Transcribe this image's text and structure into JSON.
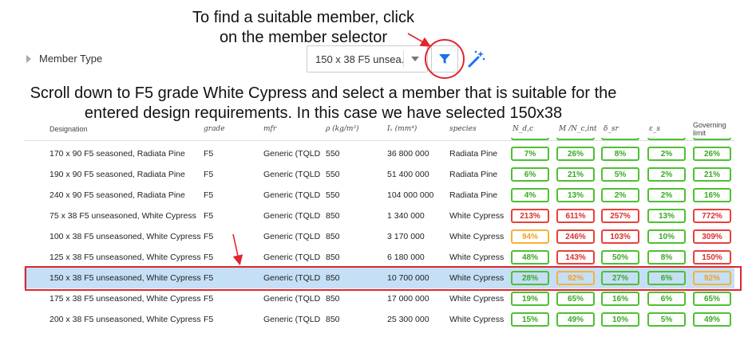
{
  "annotations": {
    "line1": "To find a suitable member, click",
    "line2": "on the member selector",
    "line3": "Scroll down to F5 grade White Cypress and select a member that is suitable for the",
    "line4": "entered design requirements. In this case we have selected 150x38"
  },
  "member": {
    "label": "Member Type",
    "selected": "150 x 38 F5 unsea..."
  },
  "icons": {
    "filter": "filter-icon",
    "wand": "magic-wand-icon",
    "expand": "expand-triangle-icon"
  },
  "colors": {
    "accent": "#1a73e8",
    "ok": "#4ec032",
    "warn": "#f5b13a",
    "fail": "#e8413c",
    "selected_row": "#c5dff6",
    "annotation": "#e0262c"
  },
  "table": {
    "headers": {
      "designation": "Designation",
      "grade": "grade",
      "mfr": "mfr",
      "rho": "ρ (kg/m³)",
      "ix": "Iₓ (mm⁴)",
      "species": "species",
      "ndc": "N_d,c",
      "mnc": "M /N_c,int",
      "dsr": "δ_sr",
      "es": "ε_s",
      "gov1": "Governing",
      "gov2": "limit"
    },
    "rows": [
      {
        "designation": "170 x 90 F5 seasoned, Radiata Pine",
        "grade": "F5",
        "mfr": "Generic (TQLD",
        "rho": "550",
        "ix": "36 800 000",
        "species": "Radiata Pine",
        "c1": "7%",
        "s1": "g",
        "c2": "26%",
        "s2": "g",
        "c3": "8%",
        "s3": "g",
        "c4": "2%",
        "s4": "g",
        "c5": "26%",
        "s5": "g"
      },
      {
        "designation": "190 x 90 F5 seasoned, Radiata Pine",
        "grade": "F5",
        "mfr": "Generic (TQLD",
        "rho": "550",
        "ix": "51 400 000",
        "species": "Radiata Pine",
        "c1": "6%",
        "s1": "g",
        "c2": "21%",
        "s2": "g",
        "c3": "5%",
        "s3": "g",
        "c4": "2%",
        "s4": "g",
        "c5": "21%",
        "s5": "g"
      },
      {
        "designation": "240 x 90 F5 seasoned, Radiata Pine",
        "grade": "F5",
        "mfr": "Generic (TQLD",
        "rho": "550",
        "ix": "104 000 000",
        "species": "Radiata Pine",
        "c1": "4%",
        "s1": "g",
        "c2": "13%",
        "s2": "g",
        "c3": "2%",
        "s3": "g",
        "c4": "2%",
        "s4": "g",
        "c5": "16%",
        "s5": "g"
      },
      {
        "designation": "75 x 38 F5 unseasoned, White Cypress",
        "grade": "F5",
        "mfr": "Generic (TQLD",
        "rho": "850",
        "ix": "1 340 000",
        "species": "White Cypress",
        "c1": "213%",
        "s1": "r",
        "c2": "611%",
        "s2": "r",
        "c3": "257%",
        "s3": "r",
        "c4": "13%",
        "s4": "g",
        "c5": "772%",
        "s5": "r"
      },
      {
        "designation": "100 x 38 F5 unseasoned, White Cypress",
        "grade": "F5",
        "mfr": "Generic (TQLD",
        "rho": "850",
        "ix": "3 170 000",
        "species": "White Cypress",
        "c1": "94%",
        "s1": "o",
        "c2": "246%",
        "s2": "r",
        "c3": "103%",
        "s3": "r",
        "c4": "10%",
        "s4": "g",
        "c5": "309%",
        "s5": "r"
      },
      {
        "designation": "125 x 38 F5 unseasoned, White Cypress",
        "grade": "F5",
        "mfr": "Generic (TQLD",
        "rho": "850",
        "ix": "6 180 000",
        "species": "White Cypress",
        "c1": "48%",
        "s1": "g",
        "c2": "143%",
        "s2": "r",
        "c3": "50%",
        "s3": "g",
        "c4": "8%",
        "s4": "g",
        "c5": "150%",
        "s5": "r"
      },
      {
        "designation": "150 x 38 F5 unseasoned, White Cypress",
        "grade": "F5",
        "mfr": "Generic (TQLD",
        "rho": "850",
        "ix": "10 700 000",
        "species": "White Cypress",
        "c1": "28%",
        "s1": "g",
        "c2": "92%",
        "s2": "o",
        "c3": "27%",
        "s3": "g",
        "c4": "6%",
        "s4": "g",
        "c5": "92%",
        "s5": "o",
        "selected": true
      },
      {
        "designation": "175 x 38 F5 unseasoned, White Cypress",
        "grade": "F5",
        "mfr": "Generic (TQLD",
        "rho": "850",
        "ix": "17 000 000",
        "species": "White Cypress",
        "c1": "19%",
        "s1": "g",
        "c2": "65%",
        "s2": "g",
        "c3": "16%",
        "s3": "g",
        "c4": "6%",
        "s4": "g",
        "c5": "65%",
        "s5": "g"
      },
      {
        "designation": "200 x 38 F5 unseasoned, White Cypress",
        "grade": "F5",
        "mfr": "Generic (TQLD",
        "rho": "850",
        "ix": "25 300 000",
        "species": "White Cypress",
        "c1": "15%",
        "s1": "g",
        "c2": "49%",
        "s2": "g",
        "c3": "10%",
        "s3": "g",
        "c4": "5%",
        "s4": "g",
        "c5": "49%",
        "s5": "g"
      }
    ]
  }
}
